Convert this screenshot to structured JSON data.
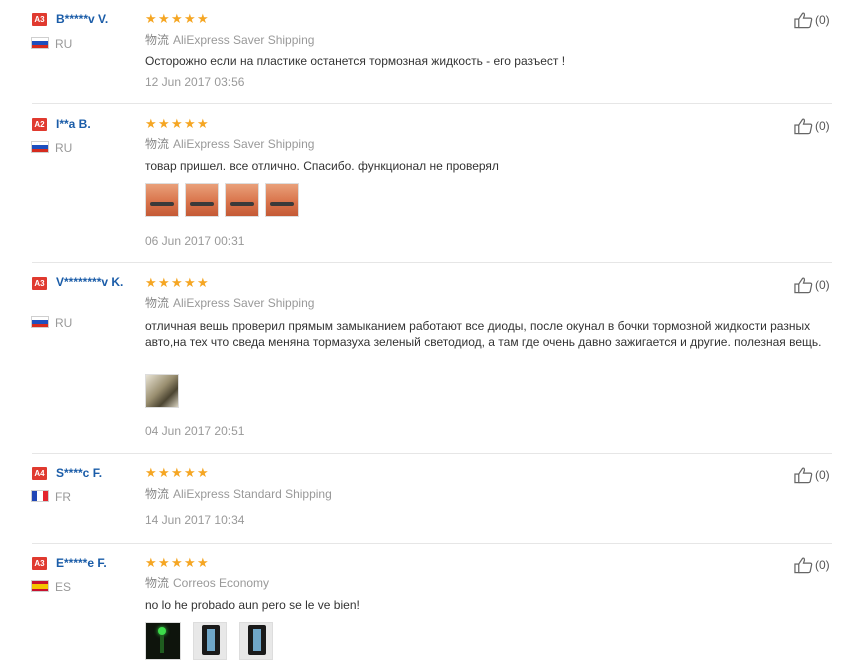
{
  "reviews": [
    {
      "level": "A3",
      "name": "B*****v V.",
      "country": "RU",
      "shipping_label": "物流",
      "shipping": "AliExpress Saver Shipping",
      "comment": "Осторожно если на пластике останется тормозная жидкость - его разъест !",
      "date": "12 Jun 2017 03:56",
      "helpful": "(0)",
      "rating": 5
    },
    {
      "level": "A2",
      "name": "I**a B.",
      "country": "RU",
      "shipping_label": "物流",
      "shipping": "AliExpress Saver Shipping",
      "comment": "товар пришел. все отлично. Спасибо. функционал не проверял",
      "date": "06 Jun 2017 00:31",
      "helpful": "(0)",
      "rating": 5
    },
    {
      "level": "A3",
      "name": "V********v K.",
      "country": "RU",
      "shipping_label": "物流",
      "shipping": "AliExpress Saver Shipping",
      "comment": "отличная вешь проверил прямым замыканием работают все диоды, после окунал в бочки тормозной жидкости разных авто,на тех что сведа меняна тормазуха зеленый светодиод, а там где очень давно зажигается и другие. полезная вещь.",
      "date": "04 Jun 2017 20:51",
      "helpful": "(0)",
      "rating": 5
    },
    {
      "level": "A4",
      "name": "S****c F.",
      "country": "FR",
      "shipping_label": "物流",
      "shipping": "AliExpress Standard Shipping",
      "date": "14 Jun 2017 10:34",
      "helpful": "(0)",
      "rating": 5
    },
    {
      "level": "A3",
      "name": "E*****e F.",
      "country": "ES",
      "shipping_label": "物流",
      "shipping": "Correos Economy",
      "comment": "no lo he probado aun pero se le ve bien!",
      "helpful": "(0)",
      "rating": 5
    }
  ],
  "icons": {
    "star": "star-icon",
    "thumb": "thumbs-up-icon"
  },
  "colors": {
    "star": "#f5a623",
    "name": "#1a5ca8",
    "badge": "#e03a2f"
  }
}
